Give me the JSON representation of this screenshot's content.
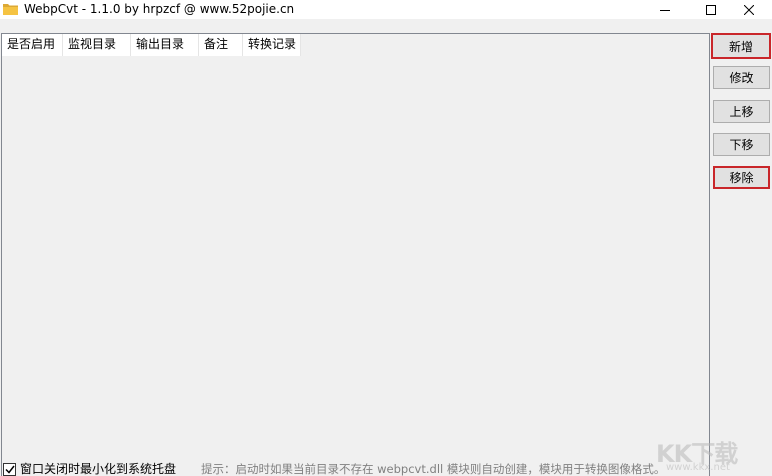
{
  "window": {
    "title": "WebpCvt - 1.1.0 by hrpzcf @ www.52pojie.cn",
    "icon": "folder-icon",
    "controls": [
      "minimize-icon",
      "maximize-icon",
      "close-icon"
    ]
  },
  "list": {
    "columns": [
      "是否启用",
      "监视目录",
      "输出目录",
      "备注",
      "转换记录"
    ],
    "rows": []
  },
  "buttons": {
    "add": "新增",
    "edit": "修改",
    "move_up": "上移",
    "move_down": "下移",
    "remove": "移除"
  },
  "footer": {
    "minimize_to_tray_label": "窗口关闭时最小化到系统托盘",
    "minimize_to_tray_checked": true,
    "hint": "提示：启动时如果当前目录不存在 webpcvt.dll 模块则自动创建，模块用于转换图像格式。"
  },
  "watermark": {
    "brand": "KK下载",
    "url": "www.kkx.net"
  },
  "colors": {
    "highlight_border": "#c9262a",
    "folder": "#f5c342",
    "list_background": "#f0f0f0"
  }
}
